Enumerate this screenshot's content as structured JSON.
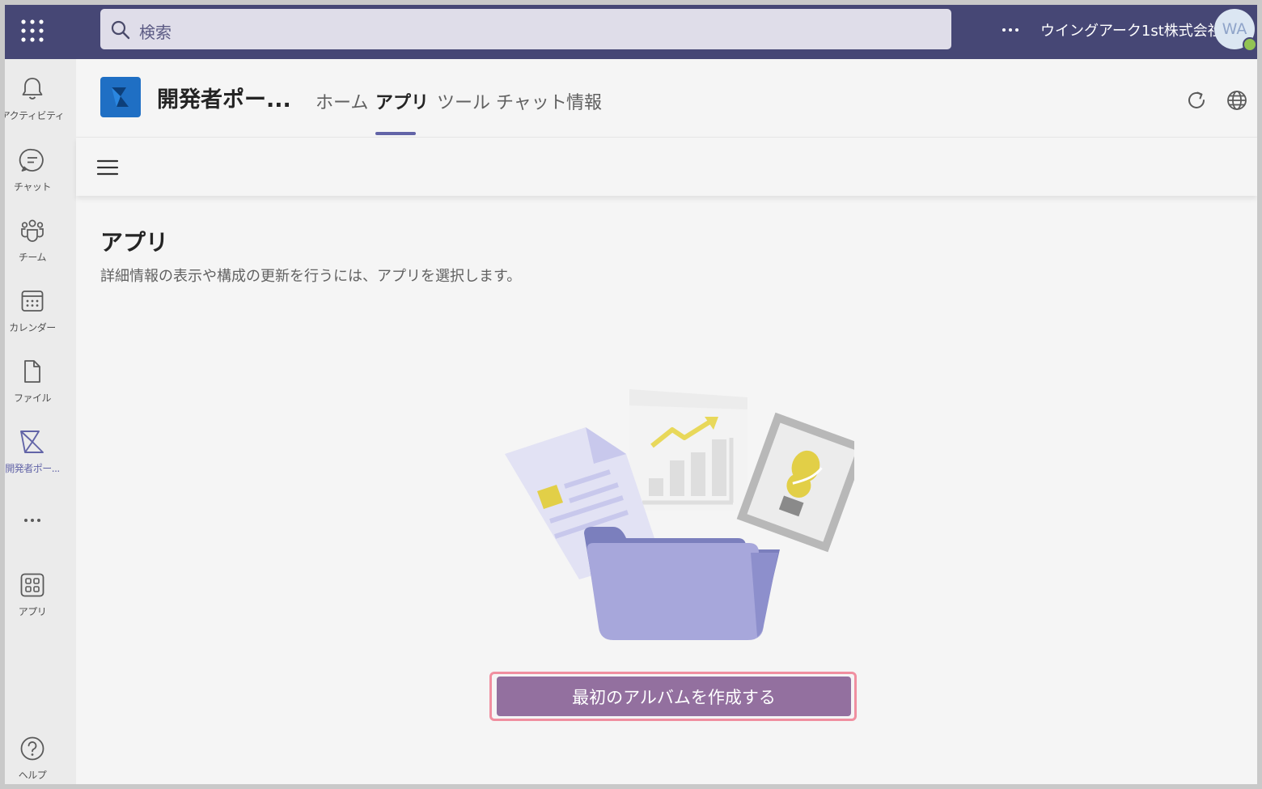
{
  "topbar": {
    "search_placeholder": "検索",
    "org_name": "ウイングアーク1st株式会社",
    "avatar_initials": "WA",
    "presence_color": "#92c353",
    "accent_color": "#464775"
  },
  "rail": {
    "items": [
      {
        "label": "アクティビティ",
        "icon": "bell-icon"
      },
      {
        "label": "チャット",
        "icon": "chat-icon"
      },
      {
        "label": "チーム",
        "icon": "teams-icon"
      },
      {
        "label": "カレンダー",
        "icon": "calendar-icon"
      },
      {
        "label": "ファイル",
        "icon": "file-icon"
      },
      {
        "label": "開発者ポー...",
        "icon": "developer-portal-icon",
        "active": true
      },
      {
        "label": "アプリ",
        "icon": "apps-icon"
      },
      {
        "label": "ヘルプ",
        "icon": "help-icon"
      }
    ]
  },
  "app": {
    "title": "開発者ポー...",
    "tabs": [
      {
        "label": "ホーム"
      },
      {
        "label": "アプリ",
        "active": true
      },
      {
        "label": "ツール"
      },
      {
        "label": "チャット"
      },
      {
        "label": "情報"
      }
    ]
  },
  "main": {
    "title": "アプリ",
    "description": "詳細情報の表示や構成の更新を行うには、アプリを選択します。",
    "cta_label": "最初のアルバムを作成する",
    "cta_color": "#93709f",
    "highlight_color": "#f08fa0"
  }
}
